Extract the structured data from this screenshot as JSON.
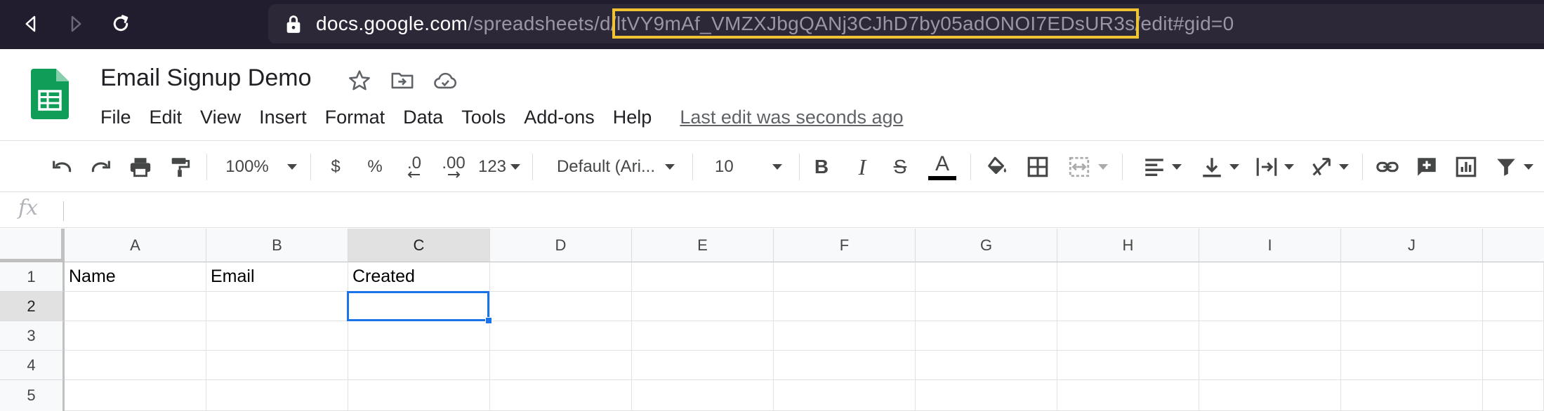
{
  "browser": {
    "url_host": "docs.google.com",
    "url_path_prefix": "/spreadsheets/d/",
    "url_doc_id": "ltVY9mAf_VMZXJbgQANj3CJhD7by05adONOI7EDsUR3s",
    "url_suffix": "/edit#gid=0",
    "highlight_color": "#f1c232"
  },
  "doc": {
    "title": "Email Signup Demo",
    "brand_color": "#0f9d58"
  },
  "menu": {
    "items": [
      "File",
      "Edit",
      "View",
      "Insert",
      "Format",
      "Data",
      "Tools",
      "Add-ons",
      "Help"
    ],
    "last_edit": "Last edit was seconds ago"
  },
  "toolbar": {
    "zoom": "100%",
    "currency": "$",
    "percent": "%",
    "decrease_decimal": ".0",
    "increase_decimal": ".00",
    "more_formats": "123",
    "font": "Default (Ari...",
    "font_size": "10",
    "bold": "B",
    "italic": "I",
    "strikethrough": "S",
    "text_color": "A",
    "accent_color": "#1a73e8"
  },
  "formula_bar": {
    "fx": "fx",
    "value": ""
  },
  "grid": {
    "columns": [
      "A",
      "B",
      "C",
      "D",
      "E",
      "F",
      "G",
      "H",
      "I",
      "J"
    ],
    "rows": [
      "1",
      "2",
      "3",
      "4",
      "5"
    ],
    "selected_column": "C",
    "selected_row": "2",
    "selected_cell": "C2",
    "cells": {
      "A1": "Name",
      "B1": "Email",
      "C1": "Created"
    }
  }
}
